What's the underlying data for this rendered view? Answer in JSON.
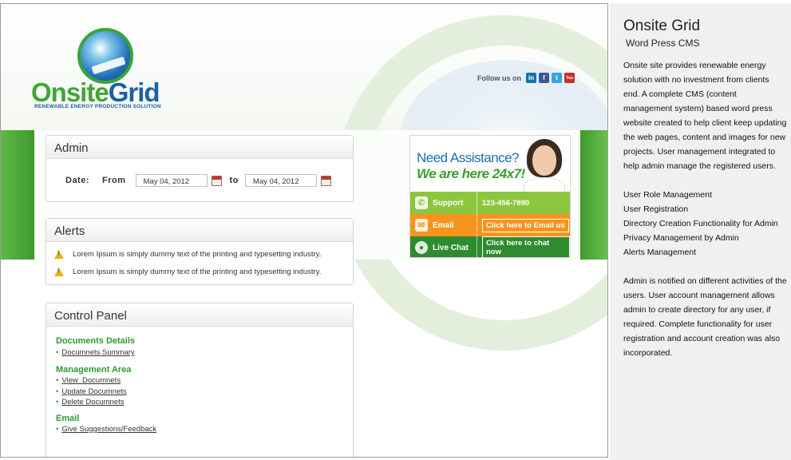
{
  "header": {
    "logo": {
      "word1": "Onsite",
      "word2": "Grid",
      "tagline": "RENEWABLE ENERGY PRODUCTION SOLUTION"
    },
    "follow_us_label": "Follow us on",
    "social_icons": [
      {
        "name": "linkedin-icon",
        "glyph": "in",
        "color": "#0e76a8"
      },
      {
        "name": "facebook-icon",
        "glyph": "f",
        "color": "#3b5998"
      },
      {
        "name": "twitter-icon",
        "glyph": "t",
        "color": "#33a7e0"
      },
      {
        "name": "youtube-icon",
        "glyph": "You",
        "color": "#c4302b"
      }
    ]
  },
  "admin": {
    "title": "Admin",
    "date_label": "Date:",
    "from_label": "From",
    "from_value": "May 04, 2012",
    "to_label": "to",
    "to_value": "May 04, 2012"
  },
  "alerts": {
    "title": "Alerts",
    "items": [
      "Lorem Ipsum is simply dummy text of the printing and typesetting industry.",
      "Lorem Ipsum is simply dummy text of the printing and typesetting industry."
    ]
  },
  "control_panel": {
    "title": "Control Panel",
    "sections": [
      {
        "heading": "Documents Details",
        "links": [
          "Documnets Summary"
        ]
      },
      {
        "heading": "Management Area",
        "links": [
          "View  Documnets",
          "Update Documnets",
          "Delete Documnets"
        ]
      },
      {
        "heading": "Email",
        "links": [
          "Give Suggestions/Feedback"
        ]
      }
    ]
  },
  "assistance": {
    "title": "Need Assistance?",
    "subtitle": "We are here 24x7!",
    "support_label": "Support",
    "support_phone": "123-456-7890",
    "email_label": "Email",
    "email_button": "Click here to Email us",
    "chat_label": "Live Chat",
    "chat_button": "Click here to chat now"
  },
  "description": {
    "title": "Onsite Grid",
    "subtitle": "Word Press CMS",
    "intro": "Onsite site provides renewable energy solution with no investment from clients end. A complete CMS (content management system) based word press website created to help client keep updating the web pages, content and images for new projects.  User management integrated to help admin manage the registered users.",
    "features": [
      "User Role Management",
      "User Registration",
      "Directory Creation Functionality for Admin",
      "Privacy Management by Admin",
      "Alerts Management"
    ],
    "closing": "Admin is notified on different activities of the users. User account management allows admin to create directory for any user, if required.  Complete functionality for user registration and account creation was also incorporated."
  },
  "colors": {
    "brand_green": "#41a535",
    "brand_blue": "#1c5fa8",
    "section_green": "#2f9a2f",
    "support_green": "#8cc63f",
    "email_orange": "#f7941d",
    "chat_green": "#2e8b2e"
  }
}
